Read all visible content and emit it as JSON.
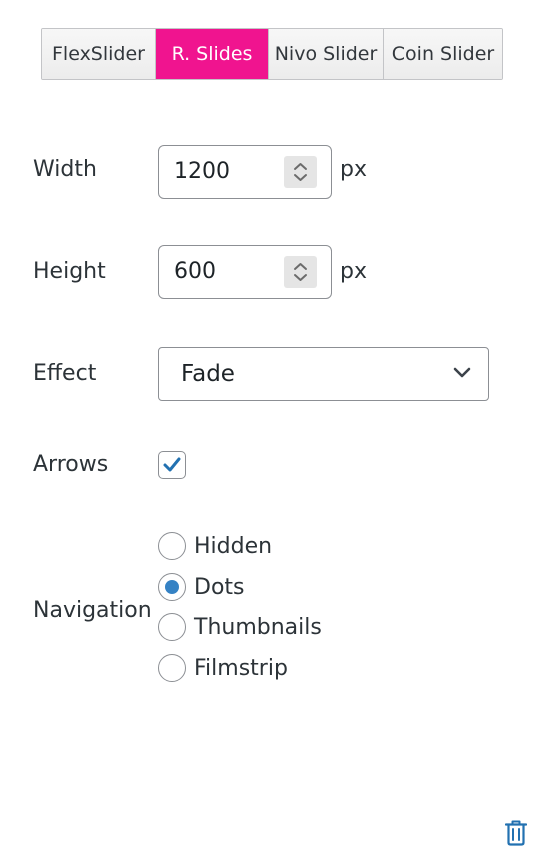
{
  "tabs": [
    {
      "label": "FlexSlider",
      "active": false
    },
    {
      "label": "R. Slides",
      "active": true
    },
    {
      "label": "Nivo Slider",
      "active": false
    },
    {
      "label": "Coin Slider",
      "active": false
    }
  ],
  "width": {
    "label": "Width",
    "value": "1200",
    "unit": "px"
  },
  "height": {
    "label": "Height",
    "value": "600",
    "unit": "px"
  },
  "effect": {
    "label": "Effect",
    "selected": "Fade"
  },
  "arrows": {
    "label": "Arrows",
    "checked": true
  },
  "navigation": {
    "label": "Navigation",
    "options": [
      {
        "label": "Hidden",
        "checked": false
      },
      {
        "label": "Dots",
        "checked": true
      },
      {
        "label": "Thumbnails",
        "checked": false
      },
      {
        "label": "Filmstrip",
        "checked": false
      }
    ]
  },
  "icons": {
    "spinner": "up-down-arrows-icon",
    "select": "chevron-down-icon",
    "checkbox": "checkmark-icon",
    "delete": "trash-icon"
  },
  "colors": {
    "active_tab": "#f0148f",
    "accent": "#3582c4",
    "delete": "#2271b1"
  }
}
